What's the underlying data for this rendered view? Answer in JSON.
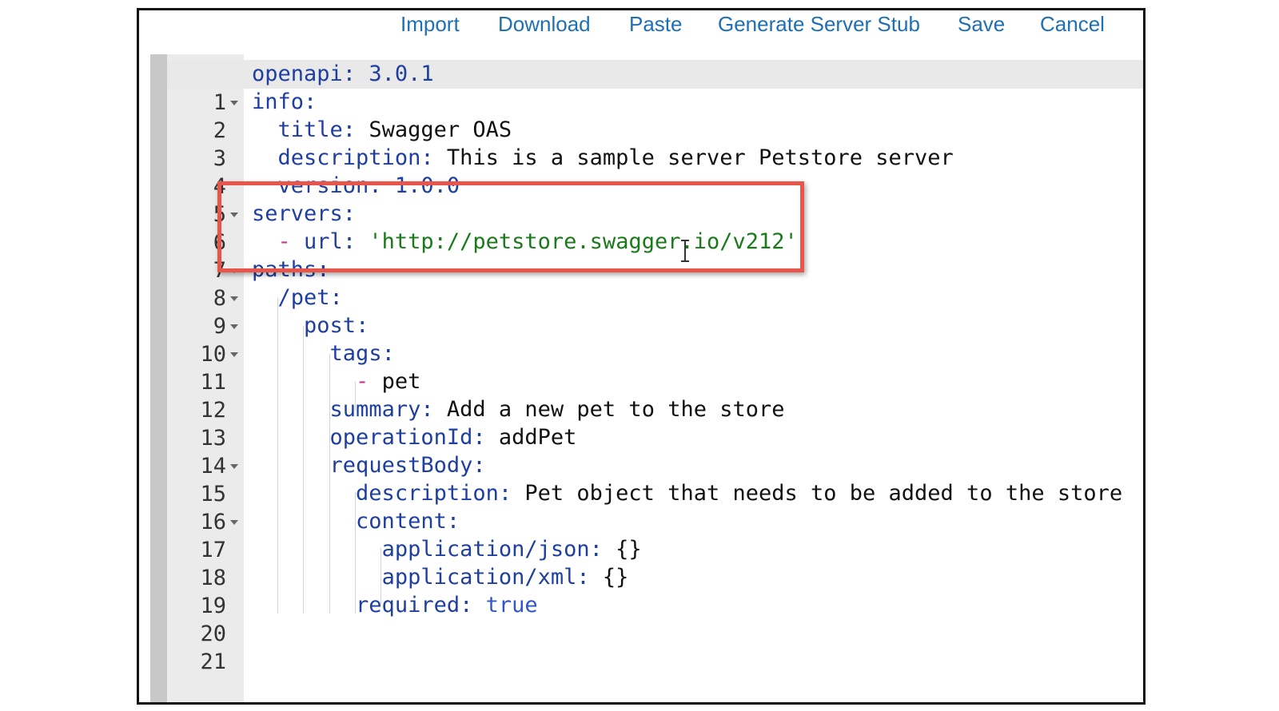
{
  "toolbar": {
    "import_label": "Import",
    "download_label": "Download",
    "paste_label": "Paste",
    "generate_label": "Generate Server Stub",
    "save_label": "Save",
    "cancel_label": "Cancel"
  },
  "colors": {
    "toolbar_link": "#1f6fb5",
    "yaml_key": "#1f3fa0",
    "yaml_string": "#1a7a1a",
    "highlight_box": "#e8554a"
  },
  "editor": {
    "lines": [
      {
        "num": "1",
        "key": "openapi",
        "value": "3.0.1"
      },
      {
        "num": "2",
        "key": "info"
      },
      {
        "num": "3",
        "key": "title",
        "value": "Swagger OAS"
      },
      {
        "num": "4",
        "key": "description",
        "value": "This is a sample server Petstore server"
      },
      {
        "num": "5",
        "key": "version",
        "value": "1.0.0"
      },
      {
        "num": "6",
        "key": "servers"
      },
      {
        "num": "7",
        "dash": "-",
        "key": "url",
        "value": "'http://petstore.swagger.io/v212'"
      },
      {
        "num": "8",
        "key": "paths"
      },
      {
        "num": "9",
        "key": "/pet"
      },
      {
        "num": "10",
        "key": "post"
      },
      {
        "num": "11",
        "key": "tags"
      },
      {
        "num": "12",
        "dash": "-",
        "value": "pet"
      },
      {
        "num": "13",
        "key": "summary",
        "value": "Add a new pet to the store"
      },
      {
        "num": "14",
        "key": "operationId",
        "value": "addPet"
      },
      {
        "num": "15",
        "key": "requestBody"
      },
      {
        "num": "16",
        "key": "description",
        "value": "Pet object that needs to be added to the store"
      },
      {
        "num": "17",
        "key": "content"
      },
      {
        "num": "18",
        "key": "application/json",
        "value": "{}"
      },
      {
        "num": "19",
        "key": "application/xml",
        "value": "{}"
      },
      {
        "num": "20",
        "key": "required",
        "value": "true"
      },
      {
        "num": "21"
      }
    ]
  }
}
